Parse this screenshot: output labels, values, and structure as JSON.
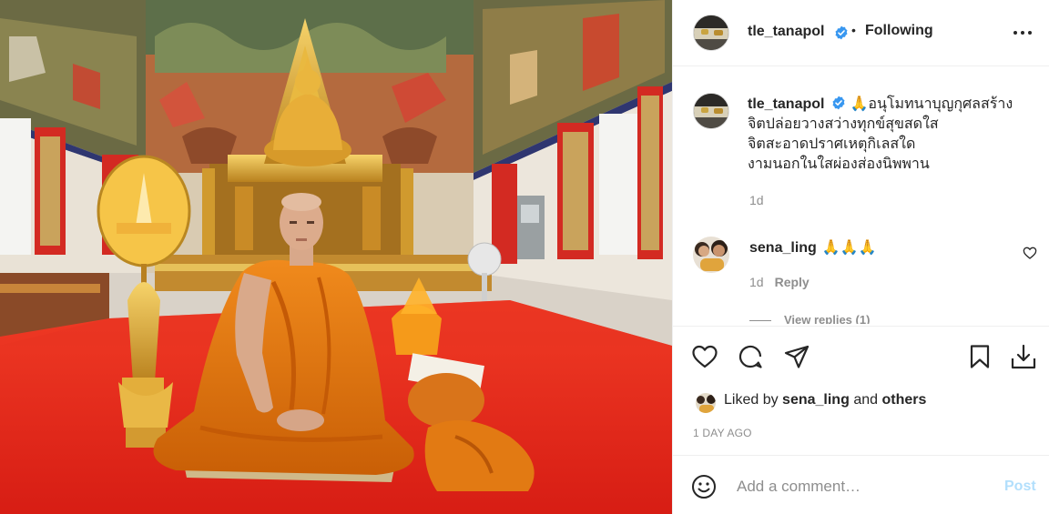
{
  "post": {
    "username": "tle_tanapol",
    "follow_separator": "•",
    "follow_status": "Following",
    "caption_lines": [
      "🙏อนุโมทนาบุญกุศลสร้าง",
      "จิตปล่อยวางสว่างทุกข์สุขสดใส",
      "จิตสะอาดปราศเหตุกิเลสใด",
      "งามนอกในใสผ่องส่องนิพพาน"
    ],
    "caption_time": "1d"
  },
  "comments": [
    {
      "username": "sena_ling",
      "text": "🙏🙏🙏",
      "time": "1d",
      "reply_label": "Reply",
      "view_replies": "View replies (1)"
    }
  ],
  "likes": {
    "prefix": "Liked by",
    "user": "sena_ling",
    "connector": "and",
    "others": "others"
  },
  "timestamp": "1 DAY AGO",
  "add_comment": {
    "placeholder": "Add a comment…",
    "post_label": "Post"
  },
  "colors": {
    "verified": "#3897f0",
    "post_disabled": "#b2dffc",
    "secondary_text": "#8e8e8e",
    "robe": "#e87a12",
    "carpet": "#e62b1c"
  },
  "icons": [
    "verified-badge-icon",
    "more-options-icon",
    "heart-icon",
    "comment-icon",
    "share-icon",
    "bookmark-icon",
    "download-icon",
    "emoji-icon"
  ]
}
